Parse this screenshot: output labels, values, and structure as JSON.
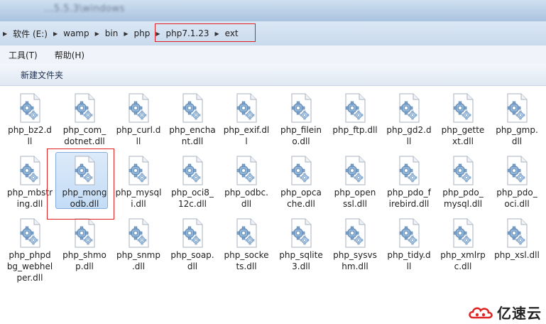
{
  "titlebar": {
    "text": "...5.5.3\\windows"
  },
  "address": {
    "crumbs": [
      "软件 (E:)",
      "wamp",
      "bin",
      "php",
      "php7.1.23",
      "ext"
    ]
  },
  "menu": {
    "tools": "工具(T)",
    "help": "帮助(H)"
  },
  "toolbar": {
    "new_folder": "新建文件夹"
  },
  "files": [
    "php_bz2.dll",
    "php_com_dotnet.dll",
    "php_curl.dll",
    "php_enchant.dll",
    "php_exif.dll",
    "php_fileinfo.dll",
    "php_ftp.dll",
    "php_gd2.dll",
    "php_gettext.dll",
    "php_gmp.dll",
    "php_mbstring.dll",
    "php_mongodb.dll",
    "php_mysqli.dll",
    "php_oci8_12c.dll",
    "php_odbc.dll",
    "php_opcache.dll",
    "php_openssl.dll",
    "php_pdo_firebird.dll",
    "php_pdo_mysql.dll",
    "php_pdo_oci.dll",
    "php_phpdbg_webhelper.dll",
    "php_shmop.dll",
    "php_snmp.dll",
    "php_soap.dll",
    "php_sockets.dll",
    "php_sqlite3.dll",
    "php_sysvshm.dll",
    "php_tidy.dll",
    "php_xmlrpc.dll",
    "php_xsl.dll"
  ],
  "file_labels": [
    [
      "php_bz2.d",
      "ll"
    ],
    [
      "php_com_",
      "dotnet.dll"
    ],
    [
      "php_curl.d",
      "ll"
    ],
    [
      "php_encha",
      "nt.dll"
    ],
    [
      "php_exif.dl",
      "l"
    ],
    [
      "php_filein",
      "o.dll"
    ],
    [
      "php_ftp.dll"
    ],
    [
      "php_gd2.d",
      "ll"
    ],
    [
      "php_gette",
      "xt.dll"
    ],
    [
      "php_gmp.",
      "dll"
    ],
    [
      "php_mbstr",
      "ing.dll"
    ],
    [
      "php_mong",
      "odb.dll"
    ],
    [
      "php_mysql",
      "i.dll"
    ],
    [
      "php_oci8_",
      "12c.dll"
    ],
    [
      "php_odbc.",
      "dll"
    ],
    [
      "php_opca",
      "che.dll"
    ],
    [
      "php_open",
      "ssl.dll"
    ],
    [
      "php_pdo_f",
      "irebird.dll"
    ],
    [
      "php_pdo_",
      "mysql.dll"
    ],
    [
      "php_pdo_",
      "oci.dll"
    ],
    [
      "php_phpd",
      "bg_webhel",
      "per.dll"
    ],
    [
      "php_shmo",
      "p.dll"
    ],
    [
      "php_snmp",
      ".dll"
    ],
    [
      "php_soap.",
      "dll"
    ],
    [
      "php_socke",
      "ts.dll"
    ],
    [
      "php_sqlite",
      "3.dll"
    ],
    [
      "php_sysvs",
      "hm.dll"
    ],
    [
      "php_tidy.d",
      "ll"
    ],
    [
      "php_xmlrp",
      "c.dll"
    ],
    [
      "php_xsl.dll"
    ]
  ],
  "selected_file_index": 11,
  "watermark": {
    "brand": "亿速云"
  },
  "colors": {
    "highlight_red": "#e02020",
    "selection_blue": "#c3dcf6",
    "logo_red": "#e02424"
  },
  "icons": {
    "file": "dll-file-gear-icon",
    "separator": "chevron-right-icon",
    "logo": "cloud-logo-icon"
  }
}
